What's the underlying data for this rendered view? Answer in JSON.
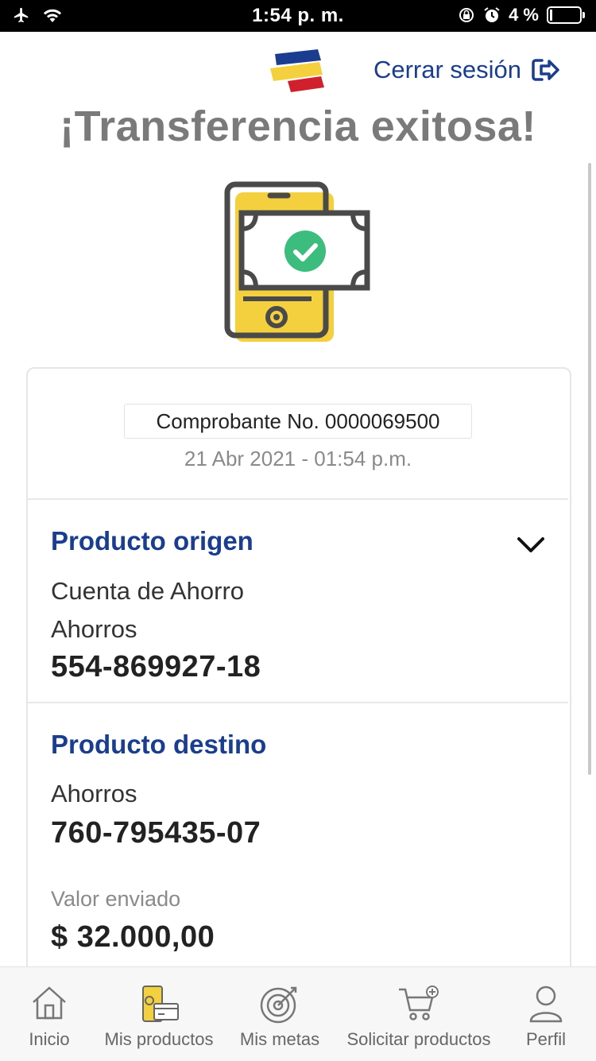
{
  "status": {
    "time": "1:54 p. m.",
    "battery": "4 %"
  },
  "header": {
    "logout_label": "Cerrar sesión"
  },
  "title": "¡Transferencia exitosa!",
  "receipt": {
    "label": "Comprobante No. 0000069500",
    "date": "21 Abr 2021 - 01:54 p.m."
  },
  "origin": {
    "heading": "Producto origen",
    "product": "Cuenta de Ahorro",
    "type": "Ahorros",
    "number": "554-869927-18"
  },
  "destination": {
    "heading": "Producto destino",
    "type": "Ahorros",
    "number": "760-795435-07"
  },
  "amount": {
    "label": "Valor enviado",
    "value": "$ 32.000,00"
  },
  "tabs": [
    {
      "label": "Inicio",
      "icon": "home-icon"
    },
    {
      "label": "Mis productos",
      "icon": "products-icon"
    },
    {
      "label": "Mis metas",
      "icon": "target-icon"
    },
    {
      "label": "Solicitar productos",
      "icon": "cart-icon"
    },
    {
      "label": "Perfil",
      "icon": "user-icon"
    }
  ],
  "colors": {
    "brand_blue": "#1a3d8f",
    "brand_yellow": "#f4d03f",
    "brand_red": "#d0202e",
    "success_green": "#3dbd7d"
  }
}
